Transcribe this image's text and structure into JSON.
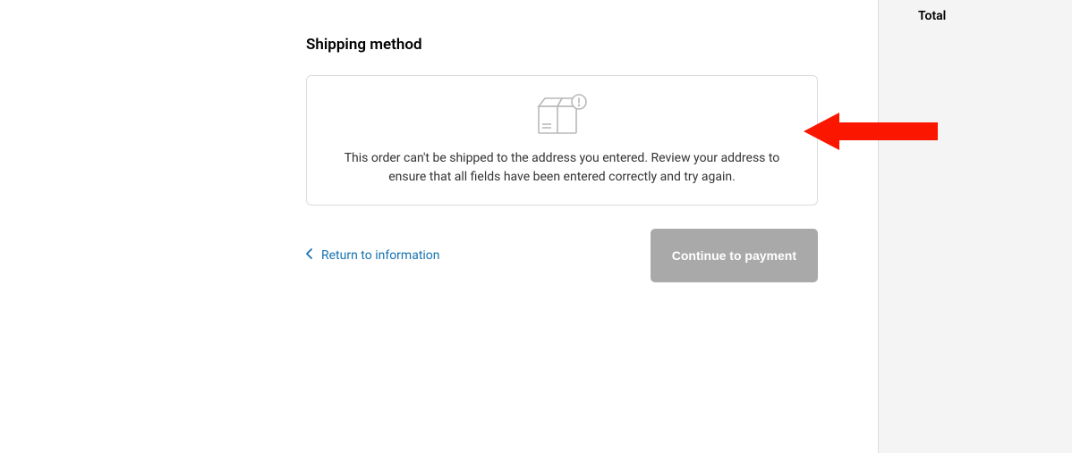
{
  "shipping": {
    "heading": "Shipping method",
    "notice": "This order can't be shipped to the address you entered. Review your address to ensure that all fields have been entered correctly and try again."
  },
  "actions": {
    "return_label": "Return to information",
    "continue_label": "Continue to payment"
  },
  "sidebar": {
    "total_label": "Total"
  }
}
